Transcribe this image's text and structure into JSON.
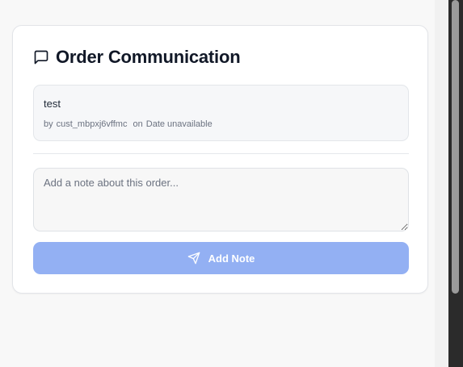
{
  "card": {
    "title": "Order Communication",
    "title_icon": "message-square-icon"
  },
  "notes": [
    {
      "text": "test",
      "by_prefix": "by",
      "author": "cust_mbpxj6vffmc",
      "on_word": "on",
      "date": "Date unavailable"
    }
  ],
  "new_note": {
    "placeholder": "Add a note about this order...",
    "value": ""
  },
  "add_button": {
    "label": "Add Note",
    "icon": "send-icon",
    "disabled": true
  },
  "colors": {
    "button_bg_disabled": "#93b0f3",
    "title_text": "#111827",
    "meta_text": "#6b7280"
  }
}
